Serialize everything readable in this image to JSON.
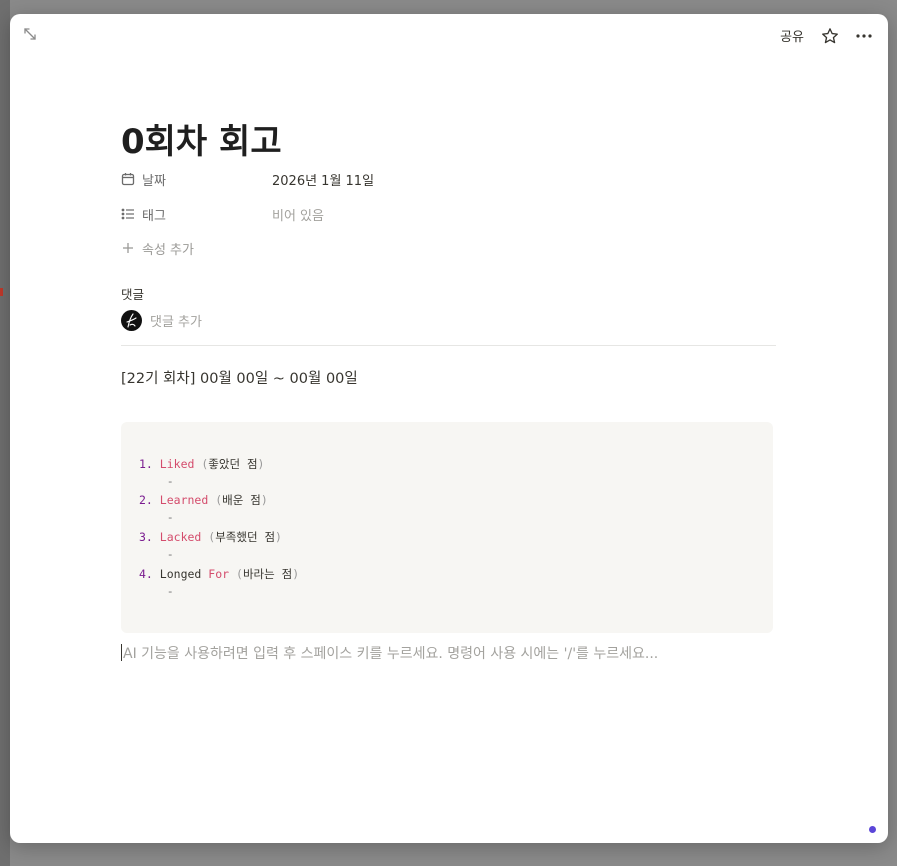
{
  "topbar": {
    "share_label": "공유"
  },
  "page": {
    "title": "0회차 회고"
  },
  "properties": [
    {
      "icon": "calendar-icon",
      "label": "날짜",
      "value": "2026년 1월 11일",
      "empty": false
    },
    {
      "icon": "list-icon",
      "label": "태그",
      "value": "비어 있음",
      "empty": true
    }
  ],
  "add_property": {
    "label": "속성 추가"
  },
  "comments": {
    "title": "댓글",
    "placeholder": "댓글 추가"
  },
  "body": {
    "heading_line": "[22기 회차] 00월 00일 ~ 00월 00일",
    "code_items": [
      {
        "num": "1.",
        "word1": "Liked",
        "word2": "",
        "paren_open": "(",
        "text": "좋았던 점",
        "paren_close": ")"
      },
      {
        "num": "2.",
        "word1": "Learned",
        "word2": "",
        "paren_open": "(",
        "text": "배운 점",
        "paren_close": ")"
      },
      {
        "num": "3.",
        "word1": "Lacked",
        "word2": "",
        "paren_open": "(",
        "text": "부족했던 점",
        "paren_close": ")"
      },
      {
        "num": "4.",
        "word1": "Longed",
        "word2": "For",
        "paren_open": "(",
        "text": "바라는 점",
        "paren_close": ")"
      }
    ],
    "dash": "-",
    "ai_hint": "AI 기능을 사용하려면 입력 후 스페이스 키를 누르세요. 명령어 사용 시에는 '/'를 누르세요..."
  },
  "colors": {
    "accent_dot": "#5b46d8",
    "code_number": "#7a1b8f",
    "code_keyword": "#d44c6c"
  }
}
